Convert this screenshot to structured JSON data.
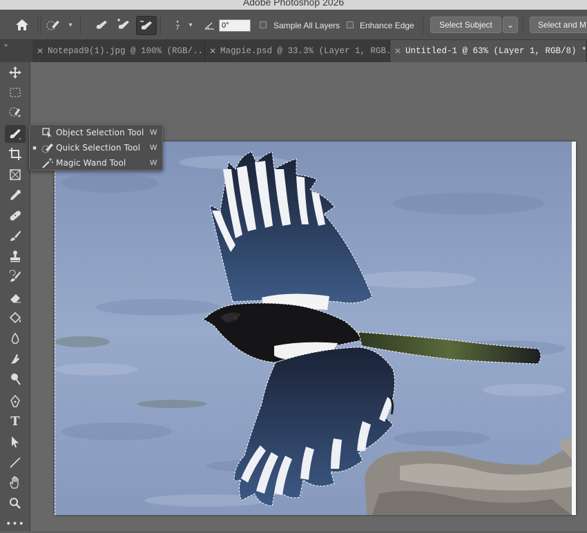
{
  "window": {
    "title": "Adobe Photoshop 2026"
  },
  "options_bar": {
    "home_icon": "home-icon",
    "brush_size": "7",
    "angle_value": "0°",
    "sample_all_layers_label": "Sample All Layers",
    "sample_all_layers_checked": false,
    "enhance_edge_label": "Enhance Edge",
    "enhance_edge_checked": false,
    "select_subject_label": "Select Subject",
    "select_mask_label": "Select and M"
  },
  "tabs": [
    {
      "label": "Notepad9(1).jpg @ 100% (RGB/...",
      "active": false
    },
    {
      "label": "Magpie.psd @ 33.3% (Layer 1, RGB...",
      "active": false
    },
    {
      "label": "Untitled-1 @ 63% (Layer 1, RGB/8) *",
      "active": true
    }
  ],
  "toolbar": {
    "tools": [
      "move-tool",
      "marquee-tool",
      "object-selection-tool",
      "quick-selection-tool",
      "crop-tool",
      "frame-tool",
      "eyedropper-tool",
      "healing-brush-tool",
      "brush-tool",
      "clone-stamp-tool",
      "history-brush-tool",
      "eraser-tool",
      "paint-bucket-tool",
      "blur-tool",
      "smudge-tool",
      "dodge-tool",
      "pen-tool",
      "type-tool",
      "path-selection-tool",
      "line-tool",
      "hand-tool",
      "zoom-tool",
      "more-tools"
    ],
    "active_tool": "quick-selection-tool"
  },
  "flyout": {
    "items": [
      {
        "label": "Object Selection Tool",
        "shortcut": "W",
        "current": false
      },
      {
        "label": "Quick Selection Tool",
        "shortcut": "W",
        "current": true
      },
      {
        "label": "Magic Wand Tool",
        "shortcut": "W",
        "current": false
      }
    ]
  },
  "colors": {
    "panel": "#535353",
    "canvas_bg": "#686868",
    "water": "#8fa2c4"
  }
}
